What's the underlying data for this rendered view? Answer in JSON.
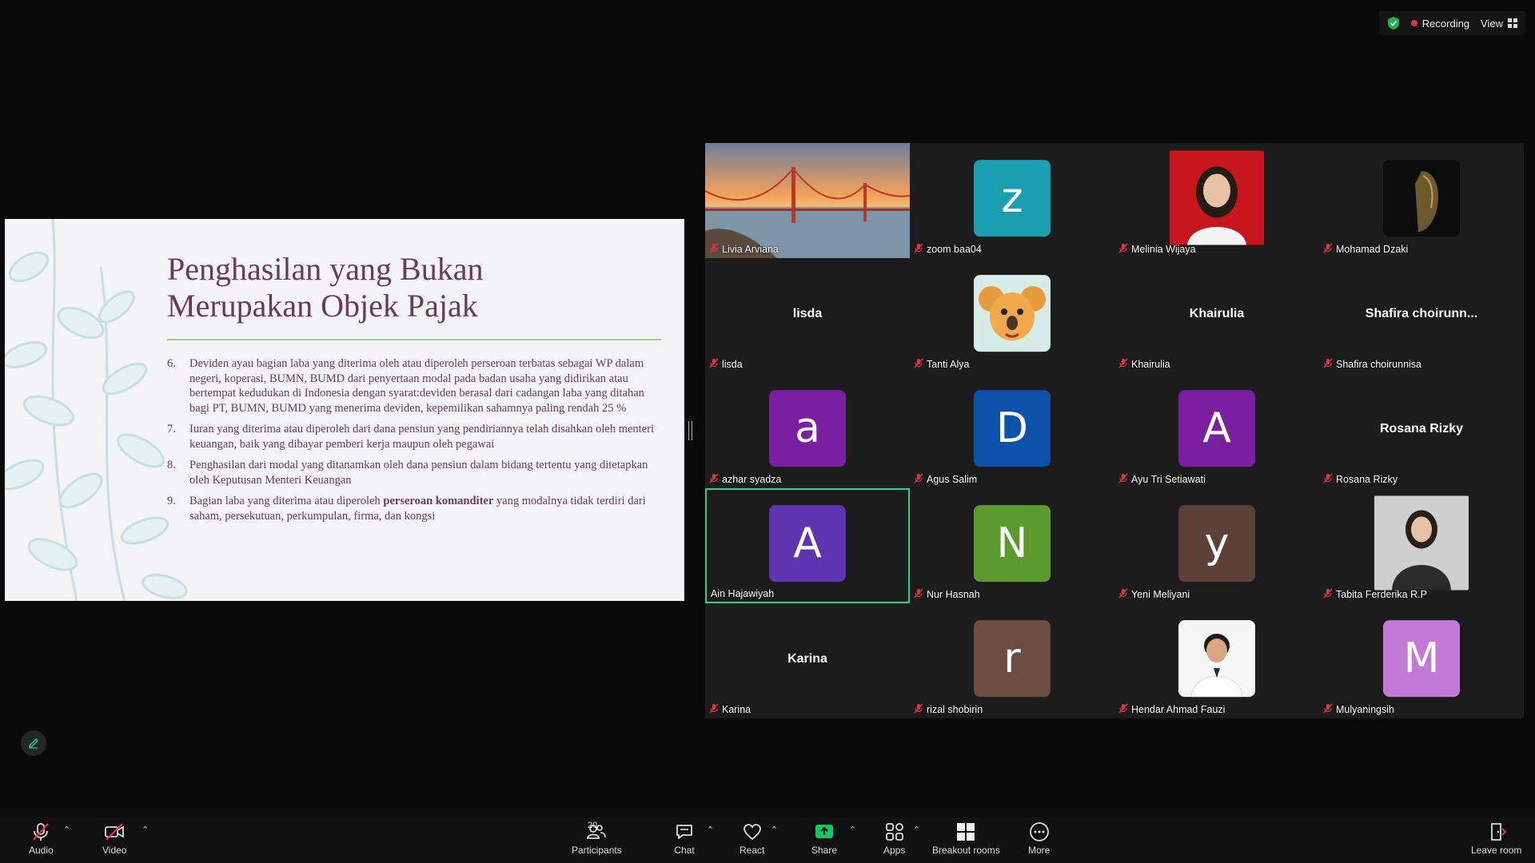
{
  "status": {
    "recording_label": "Recording",
    "view_label": "View"
  },
  "slide": {
    "title_line1": "Penghasilan yang Bukan",
    "title_line2": "Merupakan Objek Pajak",
    "items": [
      {
        "num": "6.",
        "text": "Deviden ayau bagian laba yang diterima oleh atau diperoleh perseroan terbatas sebagai WP dalam negeri, koperasi, BUMN, BUMD dari penyertaan modal pada badan usaha yang didirikan atau bertempat kedudukan di Indonesia dengan syarat:deviden berasal dari cadangan laba yang ditahan bagi PT, BUMN, BUMD yang menerima deviden, kepemilikan sahamnya paling rendah 25 %"
      },
      {
        "num": "7.",
        "text": "Iuran yang diterima atau diperoleh dari dana pensiun yang pendiriannya telah disahkan oleh menteri keuangan, baik yang dibayar pemberi kerja maupun oleh pegawai"
      },
      {
        "num": "8.",
        "text": "Penghasilan dari modal yang ditanamkan  oleh dana pensiun dalam bidang tertentu yang ditetapkan oleh Keputusan Menteri Keuangan"
      },
      {
        "num": "9.",
        "text_before": "Bagian laba yang diterima atau diperoleh ",
        "text_bold": "perseroan komanditer",
        "text_after": " yang modalnya tidak terdiri dari saham, persekutuan, perkumpulan, firma, dan kongsi"
      }
    ]
  },
  "participants": [
    {
      "name": "Livia Arviana",
      "type": "bridge",
      "muted": true
    },
    {
      "name": "zoom baa04",
      "type": "letter",
      "letter": "z",
      "color": "#1a9fb0",
      "muted": true
    },
    {
      "name": "Melinia Wijaya",
      "type": "photo-red",
      "muted": true
    },
    {
      "name": "Mohamad Dzaki",
      "type": "photo-dark",
      "muted": true
    },
    {
      "name": "lisda",
      "type": "text",
      "display": "lisda",
      "muted": true
    },
    {
      "name": "Tanti Alya",
      "type": "koala",
      "muted": true
    },
    {
      "name": "Khairulia",
      "type": "text",
      "display": "Khairulia",
      "muted": true
    },
    {
      "name": "Shafira choirunnisa",
      "type": "text",
      "display": "Shafira  choirunn...",
      "muted": true
    },
    {
      "name": "azhar syadza",
      "type": "letter",
      "letter": "a",
      "color": "#7a1fa2",
      "muted": true
    },
    {
      "name": "Agus Salim",
      "type": "letter",
      "letter": "D",
      "color": "#0d52a8",
      "muted": true
    },
    {
      "name": "Ayu Tri Setiawati",
      "type": "letter",
      "letter": "A",
      "color": "#7a1fa2",
      "muted": true
    },
    {
      "name": "Rosana Rizky",
      "type": "text",
      "display": "Rosana Rizky",
      "muted": true
    },
    {
      "name": "Ain Hajawiyah",
      "type": "letter",
      "letter": "A",
      "color": "#5e35b1",
      "muted": false,
      "active": true
    },
    {
      "name": "Nur Hasnah",
      "type": "letter",
      "letter": "N",
      "color": "#5c9a2e",
      "muted": true
    },
    {
      "name": "Yeni Meliyani",
      "type": "letter",
      "letter": "y",
      "color": "#5d4037",
      "muted": true
    },
    {
      "name": "Tabita Ferderika R.P",
      "type": "photo-gray",
      "muted": true
    },
    {
      "name": "Karina",
      "type": "text",
      "display": "Karina",
      "muted": true
    },
    {
      "name": "rizal shobirin",
      "type": "letter",
      "letter": "r",
      "color": "#6d4c41",
      "muted": true
    },
    {
      "name": "Hendar Ahmad Fauzi",
      "type": "photo-white",
      "muted": true
    },
    {
      "name": "Mulyaningsih",
      "type": "letter",
      "letter": "M",
      "color": "#c27ad6",
      "muted": true
    }
  ],
  "toolbar": {
    "audio": "Audio",
    "video": "Video",
    "participants": "Participants",
    "participant_count": "20",
    "chat": "Chat",
    "react": "React",
    "share": "Share",
    "apps": "Apps",
    "breakout": "Breakout rooms",
    "more": "More",
    "leave": "Leave room"
  },
  "colors": {
    "share_green": "#0ecb5f",
    "active_border": "#2ad08f",
    "mute_red": "#e5333a"
  }
}
